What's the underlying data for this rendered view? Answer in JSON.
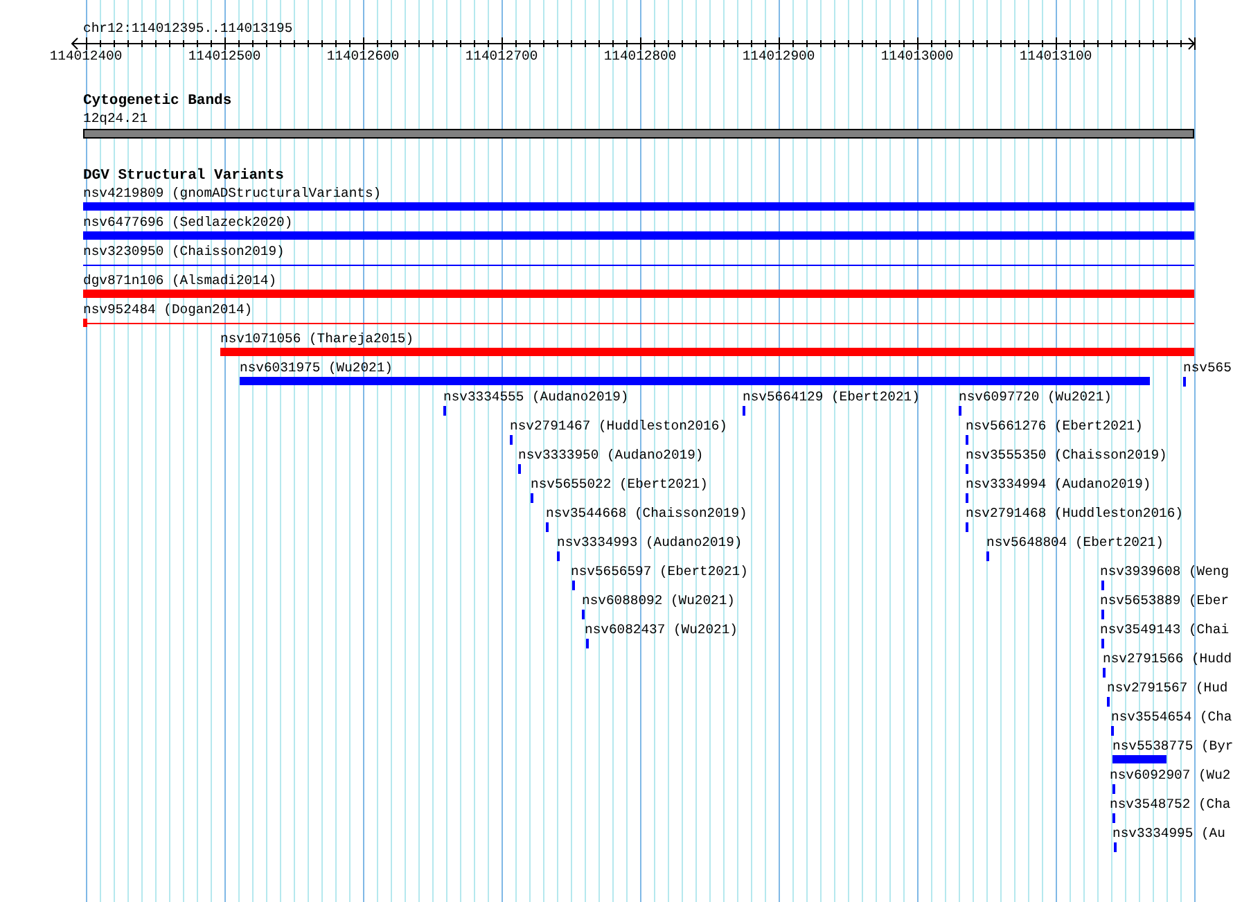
{
  "ruler": {
    "location": "chr12:114012395..114013195",
    "ticks": [
      "114012400",
      "114012500",
      "114012600",
      "114012700",
      "114012800",
      "114012900",
      "114013000",
      "114013100"
    ]
  },
  "cytoband_track": {
    "title": "Cytogenetic Bands",
    "band": "12q24.21"
  },
  "variant_track": {
    "title": "DGV Structural Variants",
    "rows": [
      [
        {
          "label": "nsv4219809 (gnomADStructuralVariants)",
          "color": "#0000ff",
          "kind": "bar"
        }
      ],
      [
        {
          "label": "nsv6477696 (Sedlazeck2020)",
          "color": "#0000ff",
          "kind": "bar"
        }
      ],
      [
        {
          "label": "nsv3230950 (Chaisson2019)",
          "color": "#0000ff",
          "kind": "line"
        }
      ],
      [
        {
          "label": "dgv871n106 (Alsmadi2014)",
          "color": "#ff0000",
          "kind": "bar"
        }
      ],
      [
        {
          "label": "nsv952484 (Dogan2014)",
          "color": "#ff0000",
          "kind": "line"
        }
      ],
      [
        {
          "label": "nsv1071056 (Thareja2015)",
          "color": "#ff0000",
          "kind": "bar"
        }
      ],
      [
        {
          "label": "nsv6031975 (Wu2021)",
          "color": "#0000ff",
          "kind": "bar"
        },
        {
          "label": "nsv565",
          "color": "#0000ff",
          "kind": "tick"
        }
      ],
      [
        {
          "label": "nsv3334555 (Audano2019)",
          "color": "#0000ff",
          "kind": "tick"
        },
        {
          "label": "nsv5664129 (Ebert2021)",
          "color": "#0000ff",
          "kind": "tick"
        },
        {
          "label": "nsv6097720 (Wu2021)",
          "color": "#0000ff",
          "kind": "tick"
        }
      ],
      [
        {
          "label": "nsv2791467 (Huddleston2016)",
          "color": "#0000ff",
          "kind": "tick"
        },
        {
          "label": "nsv5661276 (Ebert2021)",
          "color": "#0000ff",
          "kind": "tick"
        }
      ],
      [
        {
          "label": "nsv3333950 (Audano2019)",
          "color": "#0000ff",
          "kind": "tick"
        },
        {
          "label": "nsv3555350 (Chaisson2019)",
          "color": "#0000ff",
          "kind": "tick"
        }
      ],
      [
        {
          "label": "nsv5655022 (Ebert2021)",
          "color": "#0000ff",
          "kind": "tick"
        },
        {
          "label": "nsv3334994 (Audano2019)",
          "color": "#0000ff",
          "kind": "tick"
        }
      ],
      [
        {
          "label": "nsv3544668 (Chaisson2019)",
          "color": "#0000ff",
          "kind": "tick"
        },
        {
          "label": "nsv2791468 (Huddleston2016)",
          "color": "#0000ff",
          "kind": "tick"
        }
      ],
      [
        {
          "label": "nsv3334993 (Audano2019)",
          "color": "#0000ff",
          "kind": "tick"
        },
        {
          "label": "nsv5648804 (Ebert2021)",
          "color": "#0000ff",
          "kind": "tick"
        }
      ],
      [
        {
          "label": "nsv5656597 (Ebert2021)",
          "color": "#0000ff",
          "kind": "tick"
        },
        {
          "label": "nsv3939608 (Weng",
          "color": "#0000ff",
          "kind": "tick"
        }
      ],
      [
        {
          "label": "nsv6088092 (Wu2021)",
          "color": "#0000ff",
          "kind": "tick"
        },
        {
          "label": "nsv5653889 (Eber",
          "color": "#0000ff",
          "kind": "tick"
        }
      ],
      [
        {
          "label": "nsv6082437 (Wu2021)",
          "color": "#0000ff",
          "kind": "tick"
        },
        {
          "label": "nsv3549143 (Chai",
          "color": "#0000ff",
          "kind": "tick"
        }
      ],
      [
        {
          "label": "nsv2791566 (Hudd",
          "color": "#0000ff",
          "kind": "tick"
        }
      ],
      [
        {
          "label": "nsv2791567 (Hud",
          "color": "#0000ff",
          "kind": "tick"
        }
      ],
      [
        {
          "label": "nsv3554654 (Cha",
          "color": "#0000ff",
          "kind": "tick"
        }
      ],
      [
        {
          "label": "nsv5538775 (Byr",
          "color": "#0000ff",
          "kind": "bar"
        }
      ],
      [
        {
          "label": "nsv6092907 (Wu2",
          "color": "#0000ff",
          "kind": "tick"
        }
      ],
      [
        {
          "label": "nsv3548752 (Cha",
          "color": "#0000ff",
          "kind": "tick"
        }
      ],
      [
        {
          "label": "nsv3334995 (Au",
          "color": "#0000ff",
          "kind": "tick"
        }
      ]
    ]
  }
}
